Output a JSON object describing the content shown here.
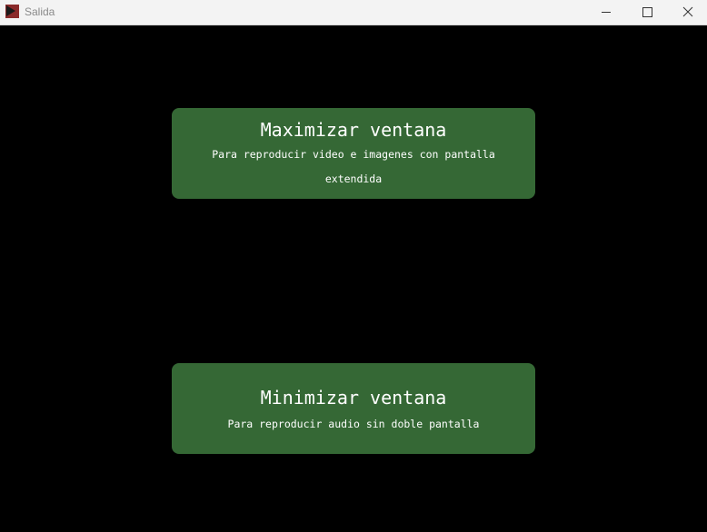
{
  "window": {
    "title": "Salida",
    "controls": {
      "minimize_icon": "minimize-icon",
      "maximize_icon": "maximize-icon",
      "close_icon": "close-icon"
    }
  },
  "colors": {
    "background": "#000000",
    "card": "#356835",
    "card_text": "#ffffff",
    "titlebar": "#f3f3f3"
  },
  "actions": {
    "maximize": {
      "title": "Maximizar ventana",
      "description": "Para reproducir video e imagenes con pantalla extendida"
    },
    "minimize": {
      "title": "Minimizar ventana",
      "description": "Para reproducir audio sin doble pantalla"
    }
  }
}
